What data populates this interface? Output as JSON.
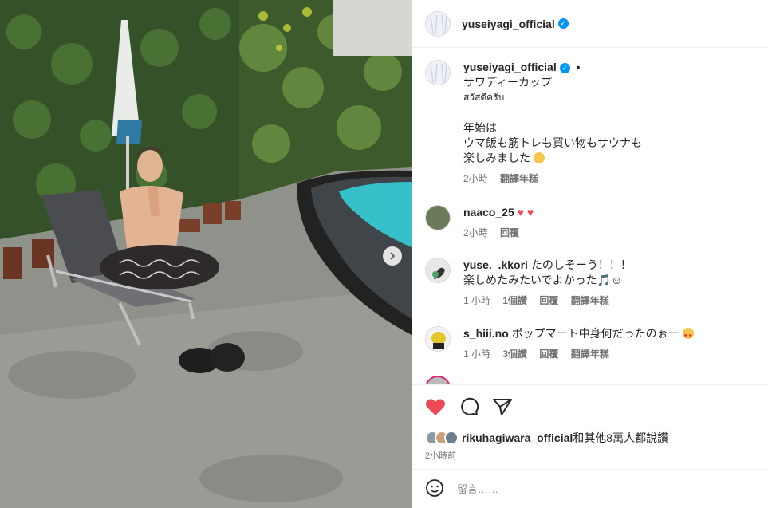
{
  "post": {
    "username": "yuseiyagi_official",
    "caption_lines": [
      "サワディーカップ",
      "สวัสดีครับ",
      "",
      "年始は",
      "ウマ飯も筋トレも買い物もサウナも",
      "楽しみました"
    ],
    "caption_time": "2小時",
    "caption_translate": "翻譯年糕"
  },
  "comments": [
    {
      "username": "naaco_25",
      "text": "",
      "time": "2小時",
      "reply": "回覆"
    },
    {
      "username": "yuse._.kkori",
      "text": "たのしそーう！！！",
      "text2": "楽しめたみたいでよかった🎵☺",
      "time": "1 小時",
      "likes": "1個讚",
      "reply": "回覆",
      "translate": "翻譯年糕"
    },
    {
      "username": "s_hiii.no",
      "text": "ポップマート中身何だったのぉー",
      "time": "1 小時",
      "likes": "3個讚",
      "reply": "回覆",
      "translate": "翻譯年糕"
    }
  ],
  "actions": {
    "liked_by_user": "rikuhagiwara_official",
    "liked_by_rest": "和其他8萬人都說讚",
    "post_time": "2小時前"
  },
  "add_comment": {
    "placeholder": "留言……"
  },
  "colors": {
    "like_red": "#ed4956",
    "verified_blue": "#0095f6"
  }
}
